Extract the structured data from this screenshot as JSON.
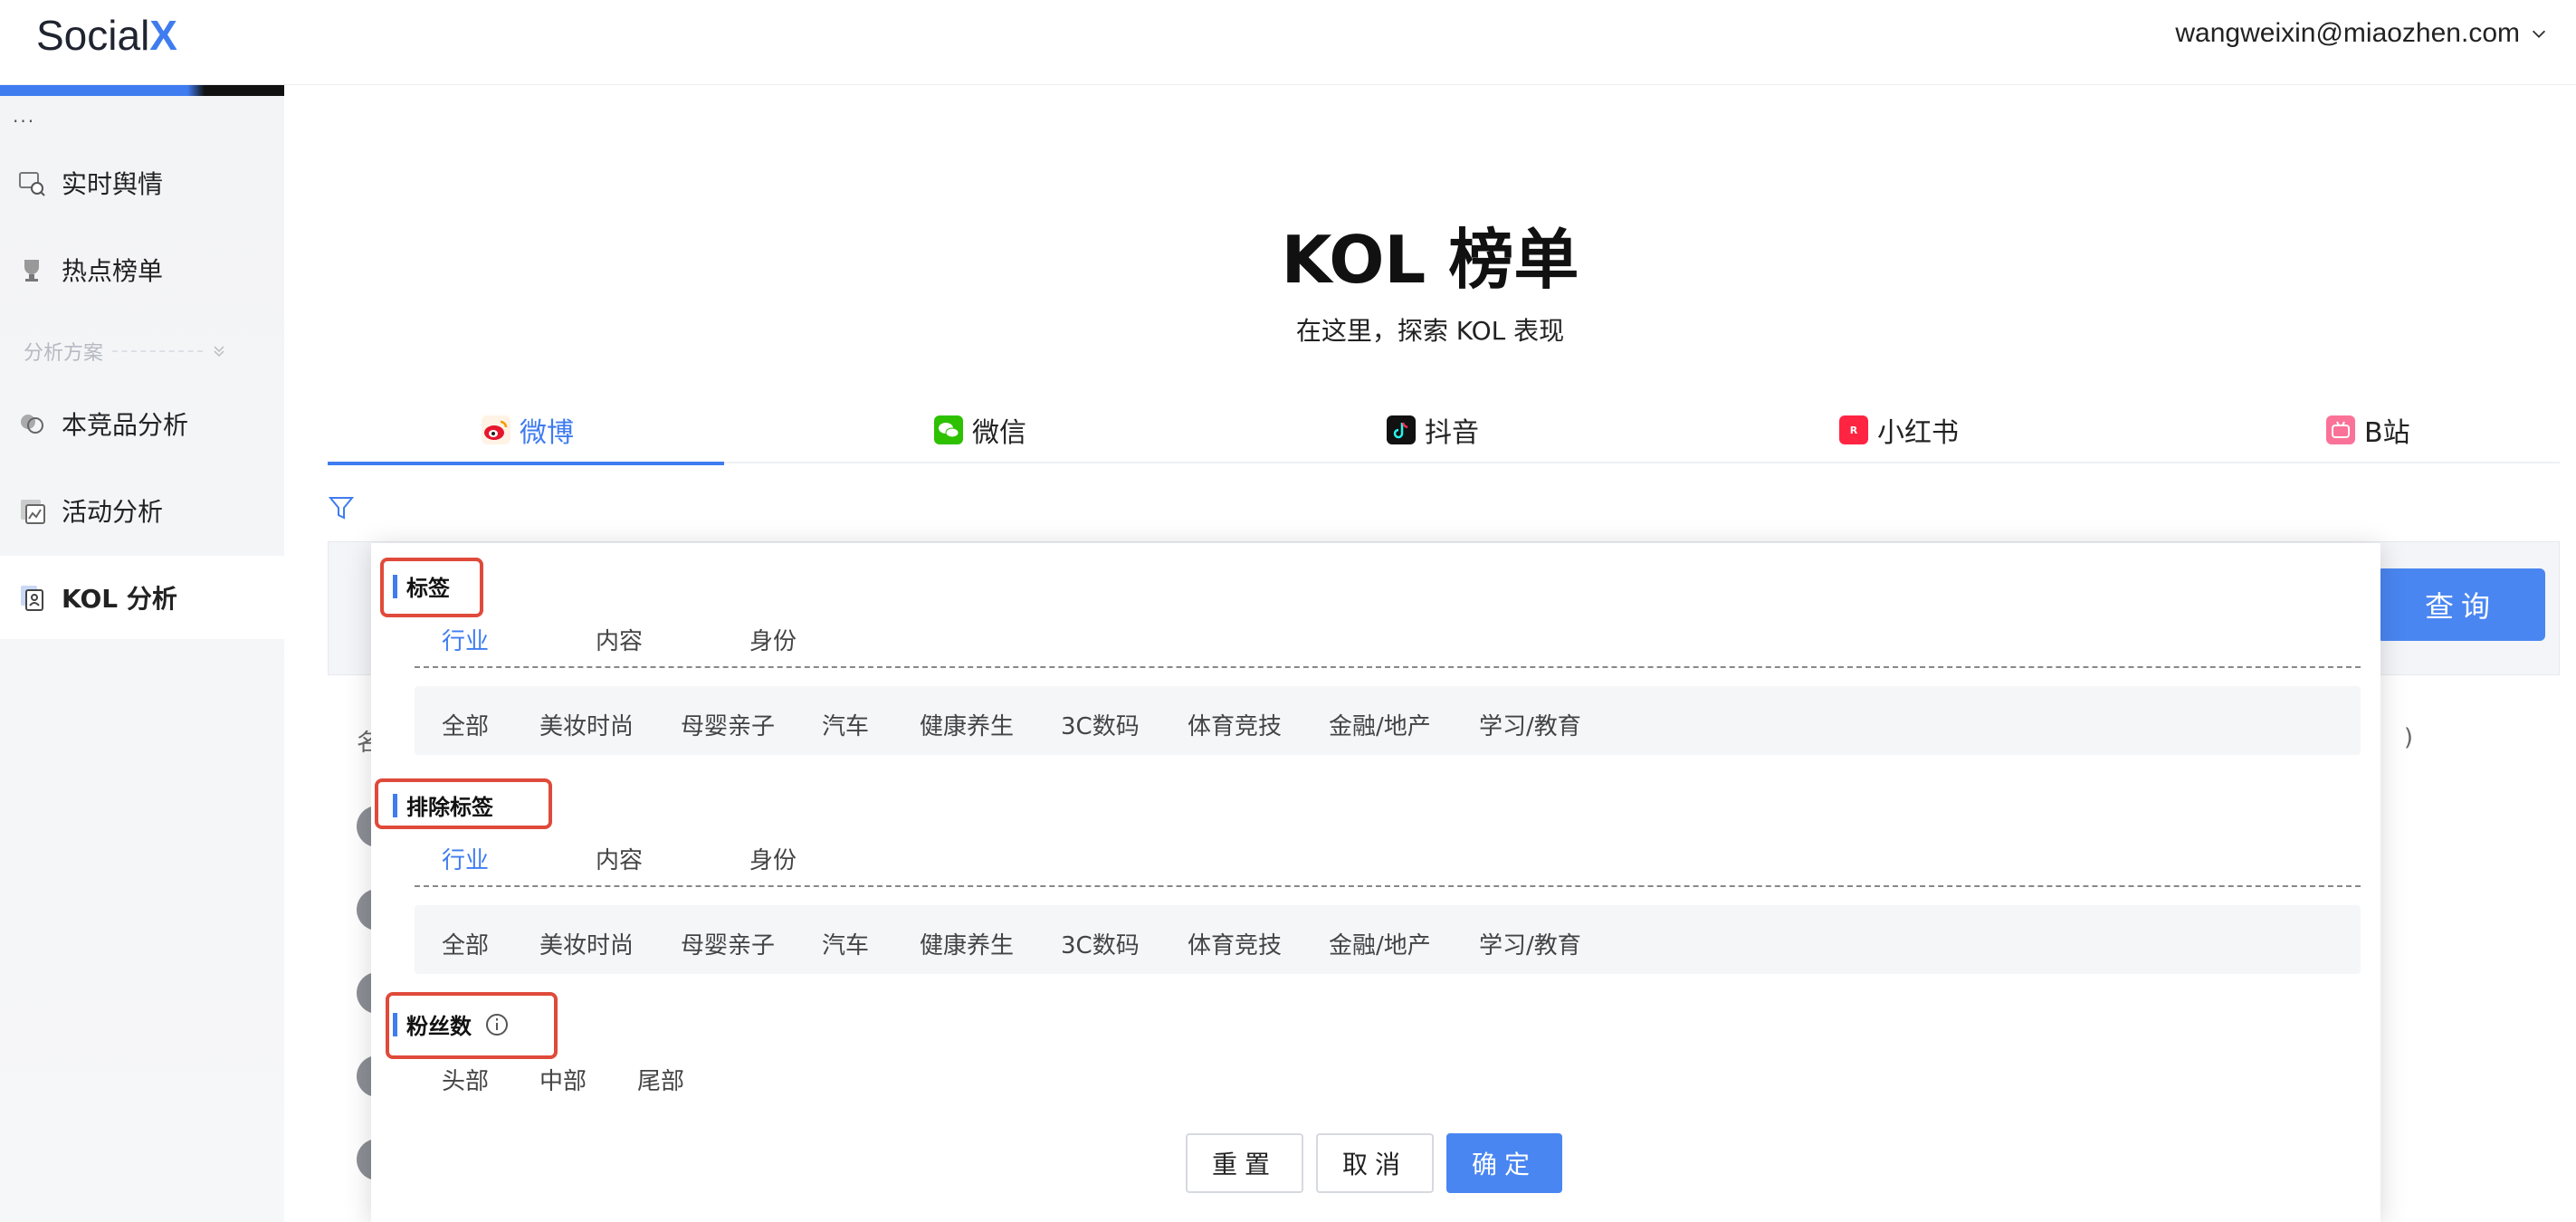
{
  "header": {
    "logo_main": "Social",
    "logo_x": "X",
    "user_email": "wangweixin@miaozhen.com"
  },
  "sidebar": {
    "menu_dots": "···",
    "items": [
      {
        "label": "实时舆情",
        "icon": "monitor-search-icon"
      },
      {
        "label": "热点榜单",
        "icon": "trophy-icon"
      },
      {
        "label": "本竞品分析",
        "icon": "compare-icon"
      },
      {
        "label": "活动分析",
        "icon": "activity-chart-icon"
      },
      {
        "label": "KOL 分析",
        "icon": "kol-doc-icon",
        "active": true
      }
    ],
    "section_label": "分析方案"
  },
  "main": {
    "title": "KOL 榜单",
    "subtitle": "在这里，探索 KOL 表现",
    "tabs": [
      {
        "label": "微博",
        "icon": "weibo-icon",
        "active": true
      },
      {
        "label": "微信",
        "icon": "wechat-icon"
      },
      {
        "label": "抖音",
        "icon": "douyin-icon"
      },
      {
        "label": "小红书",
        "icon": "xiaohongshu-icon"
      },
      {
        "label": "B站",
        "icon": "bilibili-icon"
      }
    ],
    "query_button": "查询",
    "partial_column_left": "名",
    "partial_column_right": ")"
  },
  "filter_popup": {
    "tags_section": {
      "title": "标签",
      "subtabs": [
        "行业",
        "内容",
        "身份"
      ],
      "active_subtab": "行业",
      "options": [
        "全部",
        "美妆时尚",
        "母婴亲子",
        "汽车",
        "健康养生",
        "3C数码",
        "体育竞技",
        "金融/地产",
        "学习/教育"
      ]
    },
    "exclude_section": {
      "title": "排除标签",
      "subtabs": [
        "行业",
        "内容",
        "身份"
      ],
      "active_subtab": "行业",
      "options": [
        "全部",
        "美妆时尚",
        "母婴亲子",
        "汽车",
        "健康养生",
        "3C数码",
        "体育竞技",
        "金融/地产",
        "学习/教育"
      ]
    },
    "fans_section": {
      "title": "粉丝数",
      "options": [
        "头部",
        "中部",
        "尾部"
      ]
    },
    "buttons": {
      "reset": "重置",
      "cancel": "取消",
      "confirm": "确定"
    }
  },
  "colors": {
    "accent": "#3f7cf0",
    "primary_button": "#4a86f1",
    "highlight_box": "#e04a3a"
  }
}
